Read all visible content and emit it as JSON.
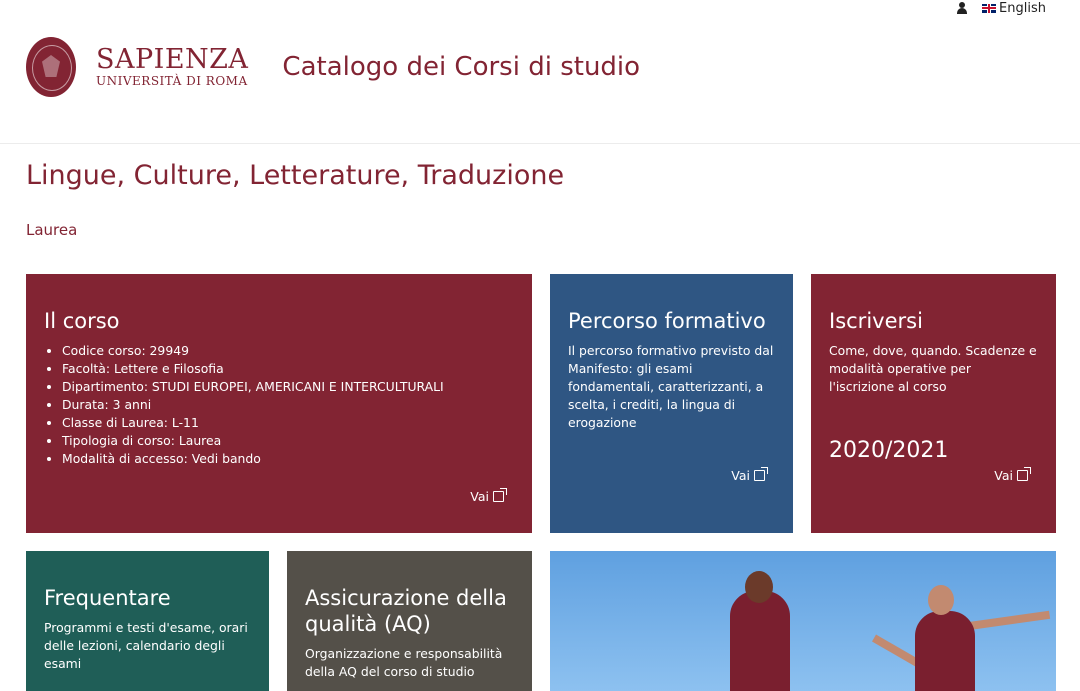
{
  "topbar": {
    "language_label": "English"
  },
  "header": {
    "brand_line1": "SAPIENZA",
    "brand_line2": "UNIVERSITÀ DI ROMA",
    "catalog_title": "Catalogo dei Corsi di studio"
  },
  "page": {
    "title": "Lingue, Culture, Letterature, Traduzione",
    "degree_type": "Laurea"
  },
  "cards": {
    "corso": {
      "title": "Il corso",
      "items": [
        "Codice corso: 29949",
        "Facoltà: Lettere e Filosofia",
        "Dipartimento: STUDI EUROPEI, AMERICANI E INTERCULTURALI",
        "Durata: 3 anni",
        "Classe di Laurea: L-11",
        "Tipologia di corso: Laurea",
        "Modalità di accesso: Vedi bando"
      ],
      "link": "Vai"
    },
    "percorso": {
      "title": "Percorso formativo",
      "text": "Il percorso formativo previsto dal Manifesto: gli esami fondamentali, caratterizzanti, a scelta, i crediti, la lingua di erogazione",
      "link": "Vai"
    },
    "iscriversi": {
      "title": "Iscriversi",
      "text": "Come, dove, quando. Scadenze e modalità operative per l'iscrizione al corso",
      "year": "2020/2021",
      "link": "Vai"
    },
    "frequentare": {
      "title": "Frequentare",
      "text": "Programmi e testi d'esame, orari delle lezioni, calendario degli esami"
    },
    "aq": {
      "title": "Assicurazione della qualità (AQ)",
      "text": "Organizzazione e responsabilità della AQ del corso di studio"
    }
  },
  "colors": {
    "brand": "#822433",
    "percorso": "#2f5683",
    "frequentare": "#1f5e57",
    "aq": "#545049"
  }
}
